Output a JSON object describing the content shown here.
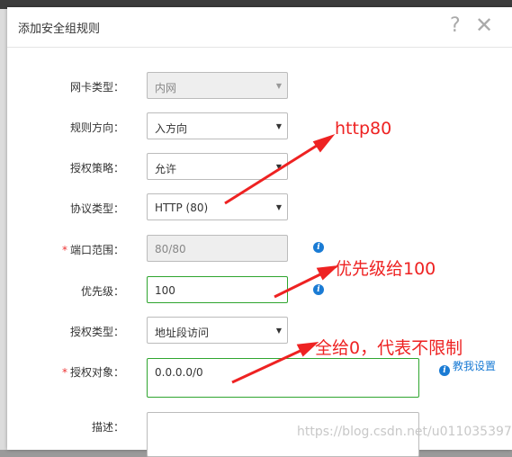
{
  "dialog": {
    "title": "添加安全组规则",
    "help_glyph": "?",
    "close_glyph": "✕"
  },
  "form": {
    "nic_type": {
      "label": "网卡类型：",
      "value": "内网"
    },
    "direction": {
      "label": "规则方向：",
      "value": "入方向"
    },
    "policy": {
      "label": "授权策略：",
      "value": "允许"
    },
    "protocol": {
      "label": "协议类型：",
      "value": "HTTP (80)"
    },
    "port_range": {
      "label": "端口范围：",
      "value": "80/80",
      "required": "*"
    },
    "priority": {
      "label": "优先级：",
      "value": "100"
    },
    "auth_type": {
      "label": "授权类型：",
      "value": "地址段访问"
    },
    "auth_object": {
      "label": "授权对象：",
      "value": "0.0.0.0/0",
      "required": "*",
      "link": "教我设置"
    },
    "description": {
      "label": "描述：",
      "value": ""
    }
  },
  "annotations": {
    "http": "http80",
    "priority": "优先级给100",
    "auth": "全给0，代表不限制"
  },
  "watermark": "https://blog.csdn.net/u011035397",
  "colors": {
    "annotation": "#e22222",
    "link": "#1a7bd4",
    "highlight_border": "#2fa52f"
  },
  "icons": {
    "info": "info-icon",
    "help": "question-icon",
    "close": "close-icon",
    "select": "caret-down-icon"
  }
}
